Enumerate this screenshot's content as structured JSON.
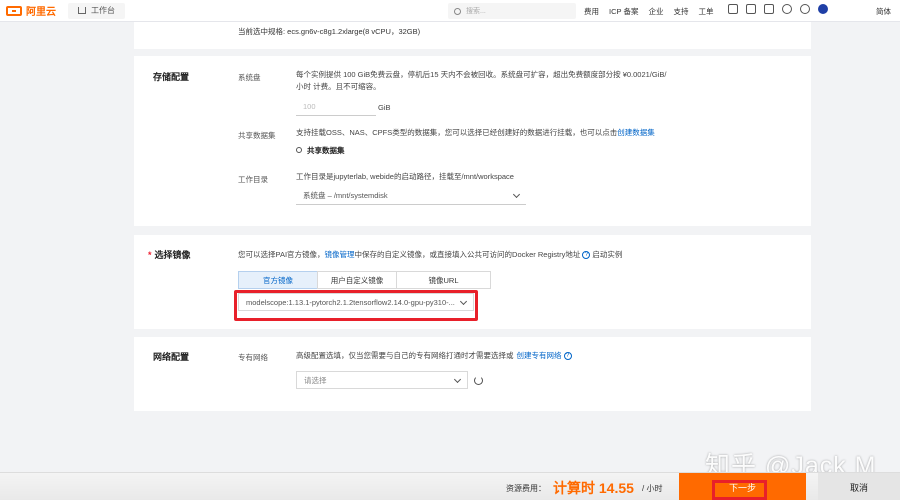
{
  "header": {
    "brand": "阿里云",
    "workspace": "工作台",
    "search_placeholder": "搜索...",
    "links": [
      "费用",
      "ICP 备案",
      "企业",
      "支持",
      "工单"
    ],
    "lang": "简体"
  },
  "spec": {
    "text": "当前选中规格: ecs.gn6v-c8g1.2xlarge(8 vCPU，32GB)"
  },
  "storage": {
    "title": "存储配置",
    "system_disk_label": "系统盘",
    "system_disk_desc_1": "每个实例提供 100 GiB免费云盘，停机后15 天内不会被回收。系统盘可扩容，超出免费额度部分按 ¥0.0021/GiB/",
    "system_disk_desc_2": "小时 计费。且不可缩容。",
    "disk_value": "100",
    "disk_unit": "GiB",
    "shared_label": "共享数据集",
    "shared_desc": "支持挂载OSS、NAS、CPFS类型的数据集，您可以选择已经创建好的数据进行挂载，也可以点击",
    "shared_link": "创建数据集",
    "shared_button": "共享数据集",
    "workdir_label": "工作目录",
    "workdir_desc": "工作目录是jupyterlab, webide的启动路径，挂载至/mnt/workspace",
    "workdir_value": "系统盘 – /mnt/systemdisk"
  },
  "image": {
    "title": "选择镜像",
    "desc_1": "您可以选择PAI官方镜像，",
    "desc_link": "镜像管理",
    "desc_2": "中保存的自定义镜像，或直接填入公共可访问的Docker Registry地址",
    "desc_3": "启动实例",
    "tabs": [
      "官方镜像",
      "用户自定义镜像",
      "镜像URL"
    ],
    "selected": "modelscope:1.13.1-pytorch2.1.2tensorflow2.14.0-gpu-py310-..."
  },
  "network": {
    "title": "网络配置",
    "label": "专有网络",
    "desc": "高级配置选填，仅当您需要与自己的专有网络打通时才需要选择或",
    "link": "创建专有网络",
    "placeholder": "请选择"
  },
  "footer": {
    "fee_label": "资源费用：",
    "fee_value": "计算时 14.55",
    "fee_unit": "/ 小时",
    "next": "下一步",
    "cancel": "取消"
  },
  "watermark": "知乎 @Jack M"
}
